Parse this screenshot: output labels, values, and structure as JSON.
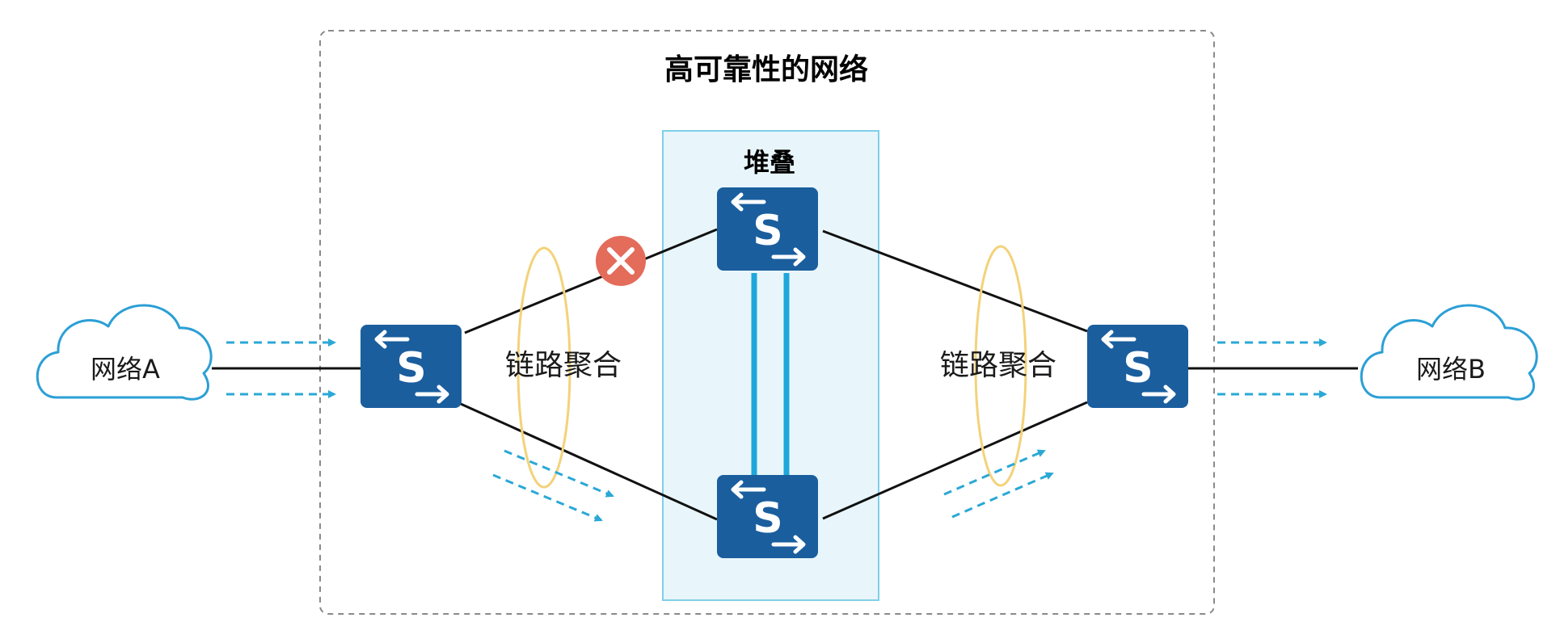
{
  "diagram": {
    "title": "高可靠性的网络",
    "stack_label": "堆叠",
    "link_aggregation_left": "链路聚合",
    "link_aggregation_right": "链路聚合",
    "network_a": "网络A",
    "network_b": "网络B",
    "switch_letter": "S"
  },
  "colors": {
    "switch_fill": "#1a5e9e",
    "stack_fill": "#e8f6fb",
    "stack_border": "#7fcfe8",
    "stack_link": "#1fa7db",
    "flow_arrow": "#2aa8d6",
    "cloud_stroke": "#2b9fd6",
    "aggregation_ring": "#f3d27a",
    "failure_mark": "#e36c5b",
    "boundary": "#8a8a8a",
    "link": "#111111"
  },
  "icons": {
    "switch": "switch-icon",
    "cloud": "cloud-icon",
    "failure": "link-failure-icon",
    "flow": "dashed-arrow-icon"
  }
}
